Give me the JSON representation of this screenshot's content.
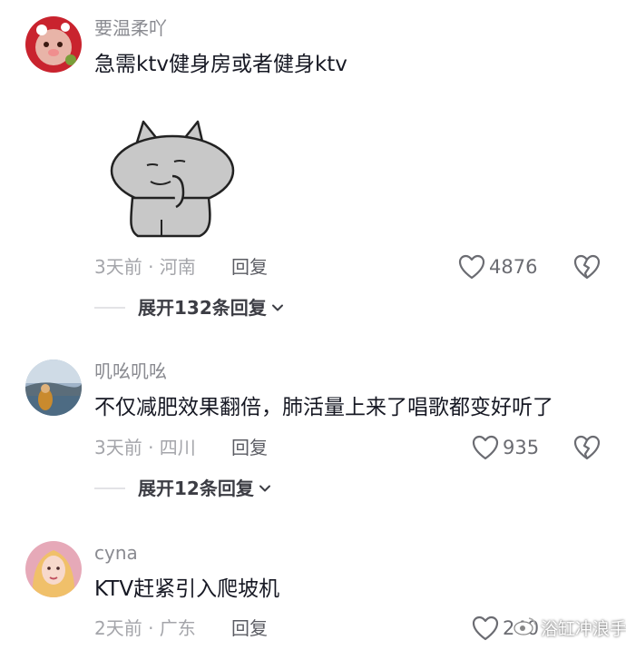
{
  "comments": [
    {
      "username": "要温柔吖",
      "text": "急需ktv健身房或者健身ktv",
      "meta": "3天前 · 河南",
      "reply_label": "回复",
      "likes": "4876",
      "expand_label": "展开132条回复"
    },
    {
      "username": "叽吆叽吆",
      "text": "不仅减肥效果翻倍，肺活量上来了唱歌都变好听了",
      "meta": "3天前 · 四川",
      "reply_label": "回复",
      "likes": "935",
      "expand_label": "展开12条回复"
    },
    {
      "username": "cyna",
      "text": "KTV赶紧引入爬坡机",
      "meta": "2天前 · 广东",
      "reply_label": "回复",
      "likes": "240"
    }
  ],
  "icons": {
    "like": "heart-outline-icon",
    "dislike": "broken-heart-icon",
    "expand": "chevron-down-icon",
    "watermark": "weibo-logo-icon"
  },
  "watermark": {
    "text": "浴缸冲浪手"
  },
  "colors": {
    "username": "#8a8b91",
    "text": "#161823",
    "meta": "#a4a5aa",
    "divider": "#e3e3e6"
  }
}
